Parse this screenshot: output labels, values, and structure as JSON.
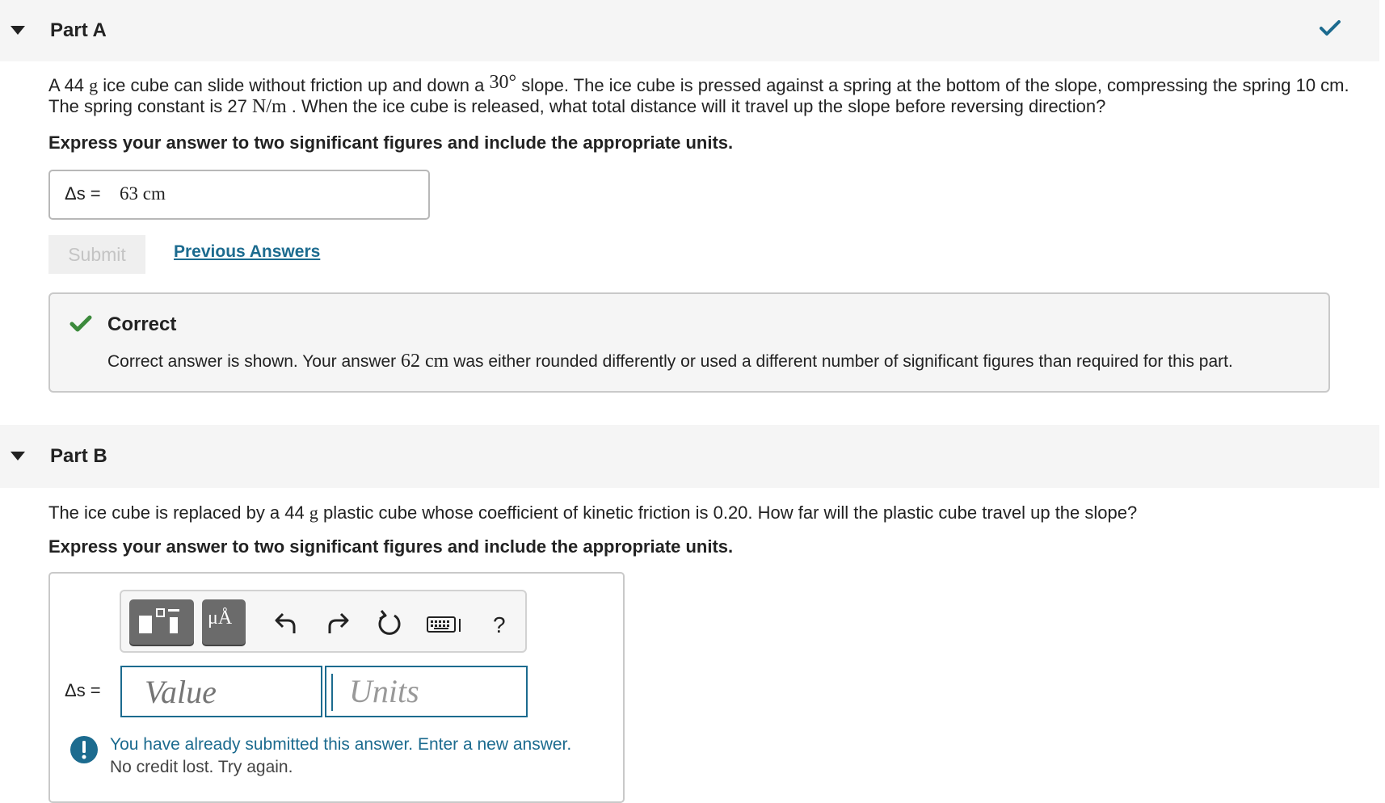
{
  "partA": {
    "title": "Part A",
    "question_line1_pre": "A 44",
    "question_unit_g": "g",
    "question_line1_mid": "ice cube can slide without friction up and down a",
    "angle": "30°",
    "question_line1_post": "slope. The ice cube is pressed against a spring at the bottom of the slope, compressing the spring 10 cm.",
    "question_line2_pre": "The spring constant is 27",
    "spring_unit": "N/m",
    "question_line2_post": ". When the ice cube is released, what total distance will it travel up the slope before reversing direction?",
    "instruction": "Express your answer to two significant figures and include the appropriate units.",
    "answer_label": "Δs =",
    "answer_value": "63 cm",
    "submit_label": "Submit",
    "previous_answers_label": "Previous Answers",
    "feedback": {
      "title": "Correct",
      "text_pre": "Correct answer is shown. Your answer",
      "your_answer": "62 cm",
      "text_post": "was either rounded differently or used a different number of significant figures than required for this part."
    }
  },
  "partB": {
    "title": "Part B",
    "question_pre": "The ice cube is replaced by a 44",
    "question_unit_g": "g",
    "question_post": "plastic cube whose coefficient of kinetic friction is 0.20. How far will the plastic cube travel up the slope?",
    "instruction": "Express your answer to two significant figures and include the appropriate units.",
    "toolbar": {
      "templates_icon": "templates-icon",
      "units_label": "μÅ",
      "undo_icon": "undo-icon",
      "redo_icon": "redo-icon",
      "reset_icon": "reset-icon",
      "keyboard_icon": "keyboard-icon",
      "help_label": "?"
    },
    "answer_label": "Δs =",
    "value_placeholder": "Value",
    "units_placeholder": "Units",
    "warning_line1": "You have already submitted this answer. Enter a new answer.",
    "warning_line2": "No credit lost. Try again."
  },
  "colors": {
    "accent": "#1c6b8f",
    "correct_green": "#3c8a3c",
    "header_bg": "#f5f5f5"
  }
}
